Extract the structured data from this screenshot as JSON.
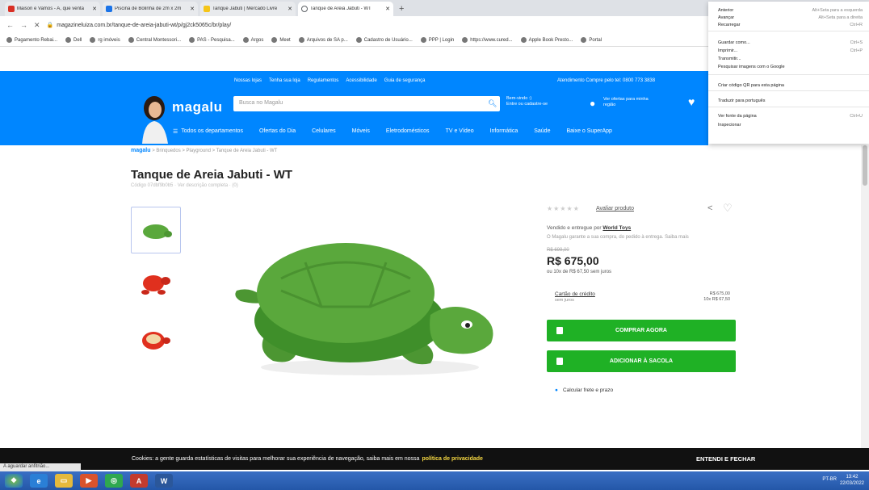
{
  "browser": {
    "tabs": [
      {
        "label": "Maison e Vamos - A, que venta",
        "color": "#d93025"
      },
      {
        "label": "Piscina de Bolinha de 2m x 2m",
        "color": "#1a73e8"
      },
      {
        "label": "Tanque Jabuti | Mercado Livre",
        "color": "#f5c518"
      },
      {
        "label": "Tanque de Areia Jabuti - WT",
        "color": "#5f6368"
      }
    ],
    "new_tab": "+",
    "url": "magazineluiza.com.br/tanque-de-areia-jabuti-wt/p/gj2ck5065c/br/play/",
    "bookmarks": [
      "Pagamento Rebai...",
      "Dell",
      "rg imóveis",
      "Central Montessori...",
      "PAS - Pesquisa...",
      "Argos",
      "Meet",
      "Arquivos de SA p...",
      "Cadastro de Usuário...",
      "PPP | Login",
      "https://www.cured...",
      "Apple Book Presto...",
      "Portal"
    ]
  },
  "context_menu": {
    "items": [
      {
        "label": "Anterior",
        "shortcut": "Alt+Seta para a esquerda"
      },
      {
        "label": "Avançar",
        "shortcut": "Alt+Seta para a direita"
      },
      {
        "label": "Recarregar",
        "shortcut": "Ctrl+R"
      },
      {
        "label": "Guardar como...",
        "shortcut": "Ctrl+S"
      },
      {
        "label": "Imprimir...",
        "shortcut": "Ctrl+P"
      },
      {
        "label": "Transmitir...",
        "shortcut": ""
      },
      {
        "label": "Pesquisar imagens com o Google",
        "shortcut": ""
      },
      {
        "label": "Criar código QR para esta página",
        "shortcut": ""
      },
      {
        "label": "Traduzir para português",
        "shortcut": ""
      },
      {
        "label": "Ver fonte da página",
        "shortcut": "Ctrl+U"
      },
      {
        "label": "Inspecionar",
        "shortcut": ""
      }
    ]
  },
  "header": {
    "top_links": [
      "Nossas lojas",
      "Tenha sua loja",
      "Regulamentos",
      "Acessibilidade",
      "Guia de segurança"
    ],
    "attendance": "Atendimento   Compre pelo tel: 0800 773 3838",
    "logo": "magalu",
    "search_placeholder": "Busca no Magalu",
    "login_line1": "Bem-vindo :)",
    "login_line2": "Entre ou cadastre-se",
    "offers_text": "Ver ofertas para minha região",
    "categories": [
      "Todos os departamentos",
      "Ofertas do Dia",
      "Celulares",
      "Móveis",
      "Eletrodomésticos",
      "TV e Vídeo",
      "Informática",
      "Saúde",
      "Baixe o SuperApp"
    ]
  },
  "product": {
    "breadcrumb_logo": "magalu",
    "breadcrumb": "> Brinquedos > Playground > Tanque de Areia Jabuti - WT",
    "title": "Tanque de Areia Jabuti - WT",
    "code_line": "Código 07dbf9b0b5 · Ver descrição completa · (0)",
    "review_link": "Avaliar produto",
    "seller_prefix": "Vendido e entregue por",
    "seller_name": "World Toys",
    "guarantee": "O Magalu garante a sua compra, do pedido à entrega. Saiba mais",
    "old_price": "R$ 699,00",
    "price": "R$ 675,00",
    "installments": "ou 10x de R$ 67,50 sem juros",
    "card_label": "Cartão de crédito",
    "card_sub": "sem juros",
    "card_value_1": "R$ 675,00",
    "card_value_2": "10x R$ 67,50",
    "buy_button": "COMPRAR AGORA",
    "cart_button": "ADICIONAR À SACOLA",
    "shipping": "Calcular frete e prazo"
  },
  "cookie": {
    "text": "Cookies: a gente guarda estatísticas de visitas para melhorar sua experiência de navegação, saiba mais em nossa",
    "policy": "política de privacidade",
    "button": "ENTENDI E FECHAR"
  },
  "status": "A aguardar anfitrião...",
  "taskbar": {
    "tray": "PT-BR",
    "time": "13:42",
    "date": "22/03/2022"
  },
  "colors": {
    "brand_blue": "#0086ff",
    "buy_green": "#1fb125",
    "turtle_green": "#5aa83c"
  }
}
